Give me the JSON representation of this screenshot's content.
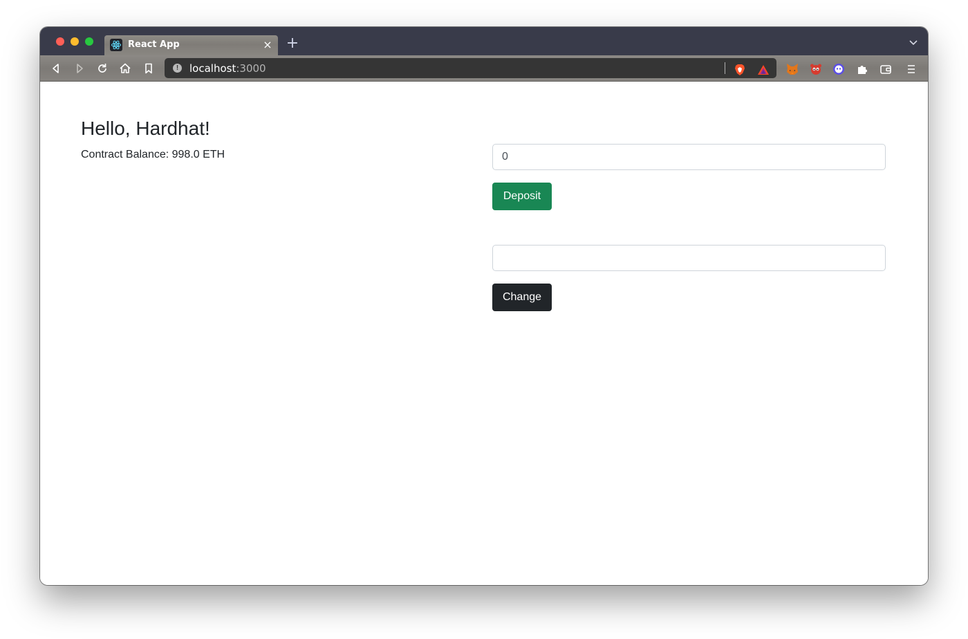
{
  "browser": {
    "tab": {
      "title": "React App",
      "close": "×"
    },
    "new_tab": "+",
    "url": {
      "host": "localhost",
      "port": ":3000",
      "info": "!"
    },
    "extensions": [
      "brave-shield-icon",
      "brave-rewards-icon",
      "metamask-fox-icon",
      "red-panda-icon",
      "purple-ghost-icon",
      "puzzle-icon",
      "wallet-icon"
    ],
    "colors": {
      "titlebar": "#393b4a",
      "tab": "#85827d",
      "urlbar": "#353535"
    }
  },
  "page": {
    "heading": "Hello, Hardhat!",
    "balance": "Contract Balance: 998.0 ETH",
    "deposit": {
      "value": "0",
      "button": "Deposit"
    },
    "change": {
      "value": "",
      "button": "Change"
    },
    "colors": {
      "success": "#198754",
      "dark": "#212529"
    }
  }
}
